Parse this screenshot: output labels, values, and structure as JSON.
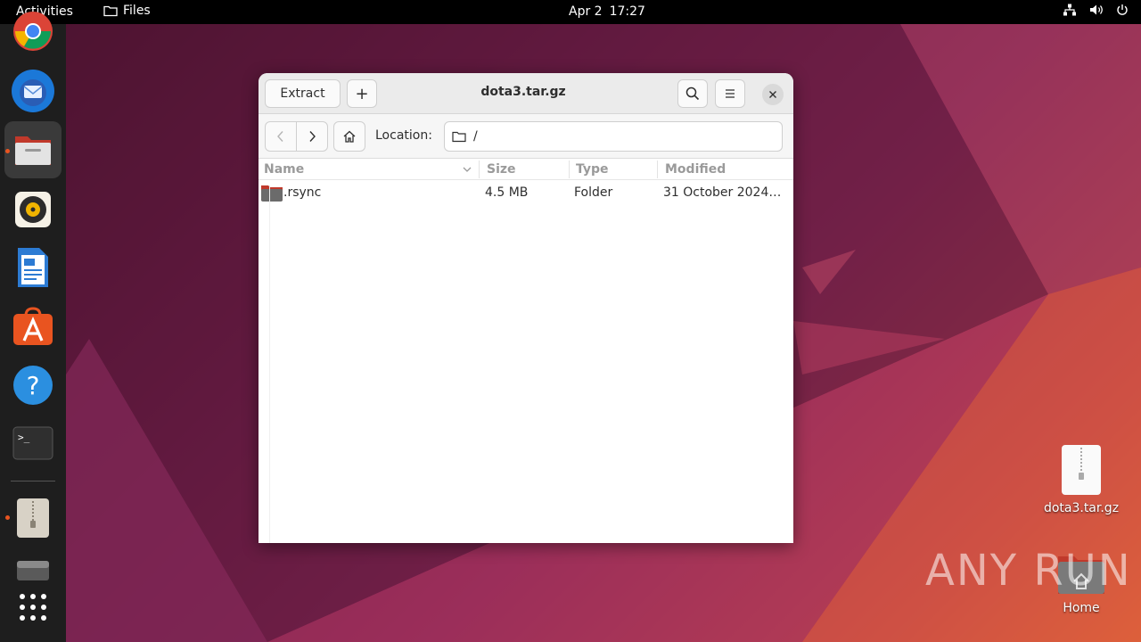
{
  "topbar": {
    "activities": "Activities",
    "app_name": "Files",
    "date": "Apr 2",
    "time": "17:27"
  },
  "dock": {
    "items": [
      {
        "name": "chrome",
        "icon": "chrome-icon"
      },
      {
        "name": "thunderbird",
        "icon": "thunderbird-icon"
      },
      {
        "name": "files",
        "icon": "files-icon",
        "active": true,
        "running": true
      },
      {
        "name": "rhythmbox",
        "icon": "rhythmbox-icon"
      },
      {
        "name": "libreoffice-writer",
        "icon": "writer-icon"
      },
      {
        "name": "app-center",
        "icon": "app-center-icon"
      },
      {
        "name": "help",
        "icon": "help-icon"
      },
      {
        "name": "terminal",
        "icon": "terminal-icon"
      },
      {
        "name": "archive-manager",
        "icon": "archive-icon",
        "running": true
      },
      {
        "name": "disk",
        "icon": "disk-icon"
      },
      {
        "name": "show-apps",
        "icon": "app-grid-icon"
      }
    ]
  },
  "window": {
    "title": "dota3.tar.gz",
    "extract_label": "Extract",
    "add_label": "+",
    "location_label": "Location:",
    "location_value": "/",
    "columns": [
      "Name",
      "Size",
      "Type",
      "Modified"
    ],
    "rows": [
      {
        "name": ".rsync",
        "size": "4.5 MB",
        "type": "Folder",
        "modified": "31 October 2024…"
      }
    ]
  },
  "desktop": {
    "icons": [
      {
        "label": "dota3.tar.gz",
        "icon": "archive-file-icon"
      },
      {
        "label": "Home",
        "icon": "home-folder-icon"
      }
    ],
    "watermark": "ANY RUN"
  },
  "colors": {
    "accent": "#e95420",
    "folder": "#c0392b"
  }
}
